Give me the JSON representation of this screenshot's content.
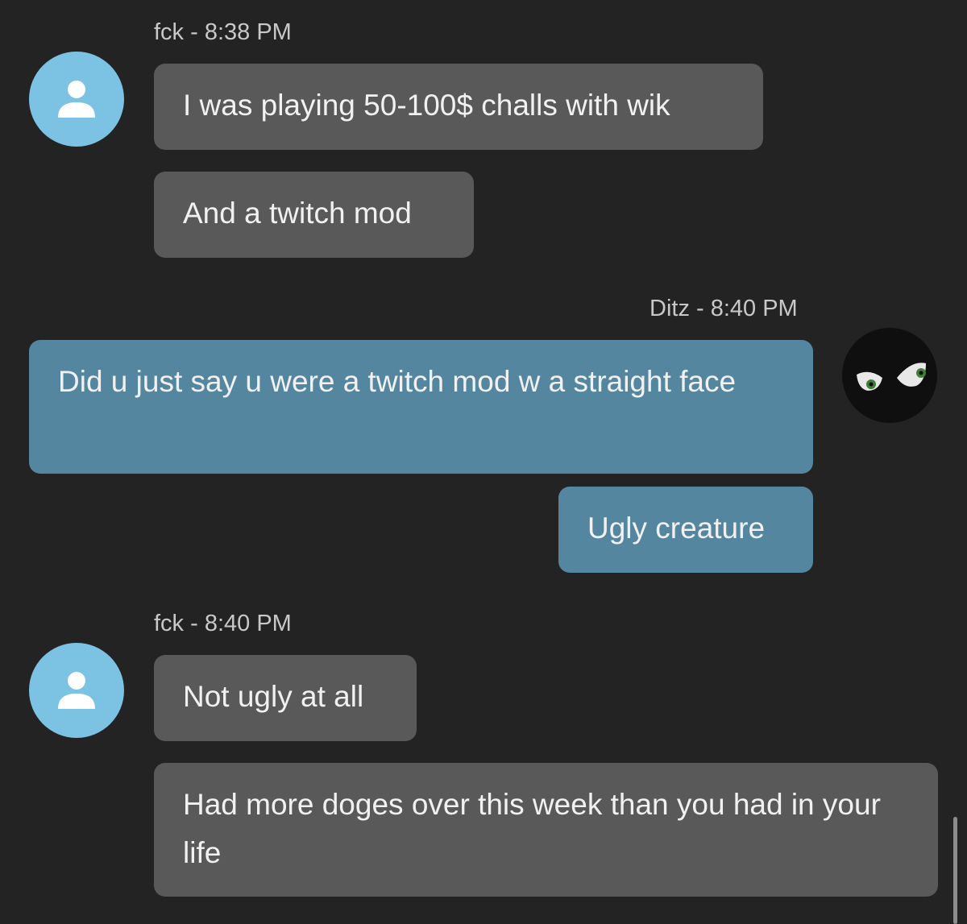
{
  "theme": {
    "background": "#232323",
    "incoming_bubble": "#595959",
    "outgoing_bubble": "#54869f",
    "default_avatar": "#7cc3e3"
  },
  "messages": [
    {
      "header": "fck - 8:38 PM",
      "avatar": "default-user-icon",
      "items": [
        "I was playing 50-100$ challs with wik",
        "And a twitch mod"
      ]
    },
    {
      "header": "Ditz - 8:40 PM",
      "avatar": "glaring-eyes-avatar",
      "items": [
        "Did u just say u were a twitch mod w a straight face",
        "Ugly creature"
      ]
    },
    {
      "header": "fck - 8:40 PM",
      "avatar": "default-user-icon",
      "items": [
        "Not ugly at all",
        "Had more doges over this week than you had in your life"
      ]
    }
  ]
}
